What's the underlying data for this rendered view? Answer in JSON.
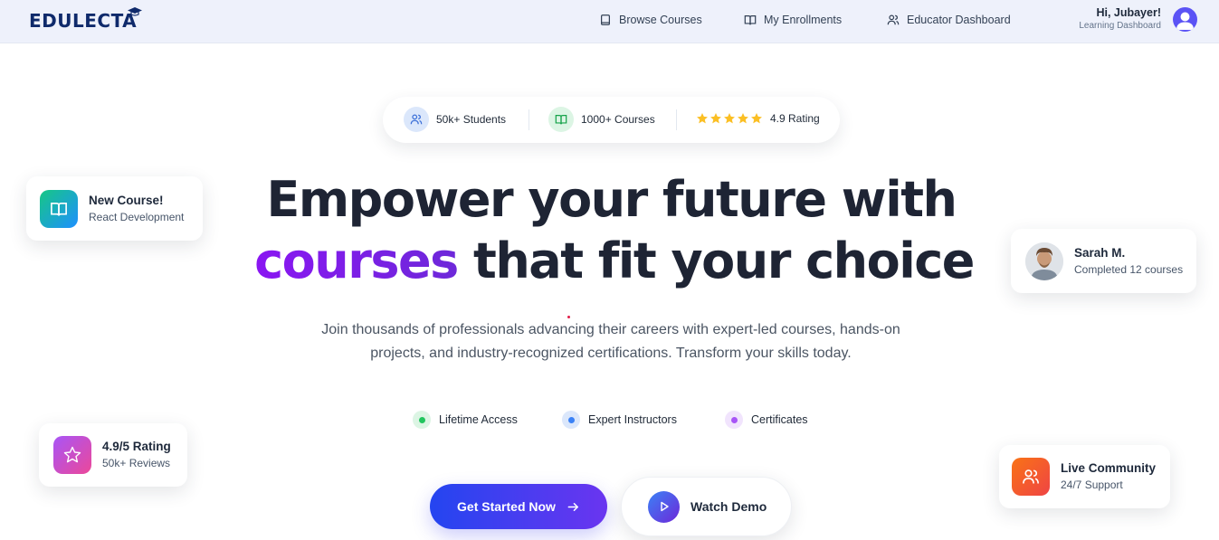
{
  "navbar": {
    "logo_text": "EDULECTA",
    "links": {
      "browse": "Browse Courses",
      "enrollments": "My Enrollments",
      "educator": "Educator Dashboard"
    },
    "user": {
      "greeting": "Hi, Jubayer!",
      "subtitle": "Learning Dashboard"
    }
  },
  "stats": {
    "students": "50k+ Students",
    "courses": "1000+ Courses",
    "rating": "4.9 Rating",
    "rating_stars": 5
  },
  "hero": {
    "line1": "Empower your future with",
    "highlight": "courses",
    "line2_rest": "that fit your choice",
    "description": "Join thousands of professionals advancing their careers with expert-led courses, hands-on projects, and industry-recognized certifications. Transform your skills today."
  },
  "features": [
    {
      "label": "Lifetime Access",
      "color": "#22c55e"
    },
    {
      "label": "Expert Instructors",
      "color": "#3b82f6"
    },
    {
      "label": "Certificates",
      "color": "#a855f7"
    }
  ],
  "cta": {
    "primary": "Get Started Now",
    "secondary": "Watch Demo"
  },
  "cards": {
    "new_course": {
      "title": "New Course!",
      "subtitle": "React Development"
    },
    "rating": {
      "title": "4.9/5 Rating",
      "subtitle": "50k+ Reviews"
    },
    "testimonial": {
      "title": "Sarah M.",
      "subtitle": "Completed 12 courses"
    },
    "community": {
      "title": "Live Community",
      "subtitle": "24/7 Support"
    }
  },
  "colors": {
    "brand_navy": "#0f2a6b",
    "accent_purple": "#7c1ff0",
    "primary_blue": "#2445f0"
  }
}
